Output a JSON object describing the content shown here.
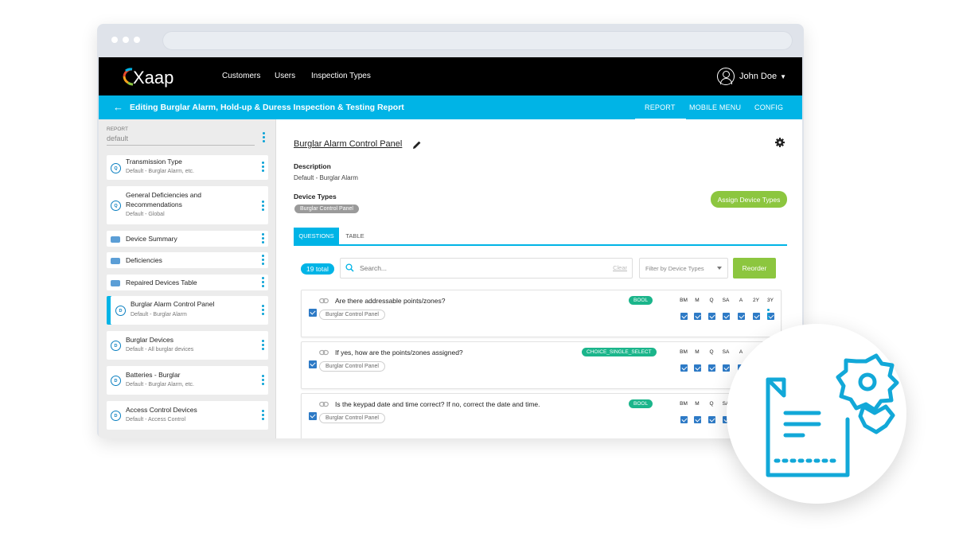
{
  "app": {
    "logo_text": "Xaap",
    "nav": [
      "Customers",
      "Users",
      "Inspection Types"
    ],
    "user_name": "John Doe"
  },
  "subheader": {
    "title": "Editing Burglar Alarm, Hold-up & Duress Inspection & Testing Report",
    "tabs": [
      "REPORT",
      "MOBILE MENU",
      "CONFIG"
    ],
    "active_tab": "REPORT"
  },
  "sidebar": {
    "report_label": "REPORT",
    "report_value": "default",
    "items": [
      {
        "title": "Transmission Type",
        "subtitle": "Default - Burglar Alarm, etc.",
        "icon": "Q"
      },
      {
        "title": "General Deficiencies and Recommendations",
        "subtitle": "Default - Global",
        "icon": "Q"
      },
      {
        "title": "Device Summary",
        "subtitle": "",
        "icon": "doc"
      },
      {
        "title": "Deficiencies",
        "subtitle": "",
        "icon": "doc"
      },
      {
        "title": "Repaired Devices Table",
        "subtitle": "",
        "icon": "doc"
      },
      {
        "title": "Burglar Alarm Control Panel",
        "subtitle": "Default - Burglar Alarm",
        "icon": "D"
      },
      {
        "title": "Burglar Devices",
        "subtitle": "Default - All burglar devices",
        "icon": "D"
      },
      {
        "title": "Batteries - Burglar",
        "subtitle": "Default - Burglar Alarm, etc.",
        "icon": "D"
      },
      {
        "title": "Access Control Devices",
        "subtitle": "Default - Access Control",
        "icon": "D"
      }
    ]
  },
  "main": {
    "title": "Burglar Alarm Control Panel",
    "description_label": "Description",
    "description_value": "Default - Burglar Alarm",
    "device_types_label": "Device Types",
    "device_type_chip": "Burglar Control Panel",
    "assign_button": "Assign Device Types",
    "tabs": [
      "QUESTIONS",
      "TABLE"
    ],
    "total_badge": "19 total",
    "search_placeholder": "Search...",
    "clear_label": "Clear",
    "filter_placeholder": "Filter by Device Types",
    "reorder_button": "Reorder",
    "frequencies": [
      "BM",
      "M",
      "Q",
      "SA",
      "A",
      "2Y",
      "3Y"
    ],
    "questions": [
      {
        "text": "Are there addressable points/zones?",
        "type": "BOOL",
        "device_chip": "Burglar Control Panel"
      },
      {
        "text": "If yes, how are the points/zones assigned?",
        "type": "CHOICE_SINGLE_SELECT",
        "device_chip": "Burglar Control Panel"
      },
      {
        "text": "Is the keypad date and time correct? If no, correct the date and time.",
        "type": "BOOL",
        "device_chip": "Burglar Control Panel"
      }
    ]
  },
  "colors": {
    "accent": "#00b4e6",
    "green": "#8cc63f",
    "type_badge": "#1bb58b",
    "checkbox": "#2d7ac6"
  }
}
